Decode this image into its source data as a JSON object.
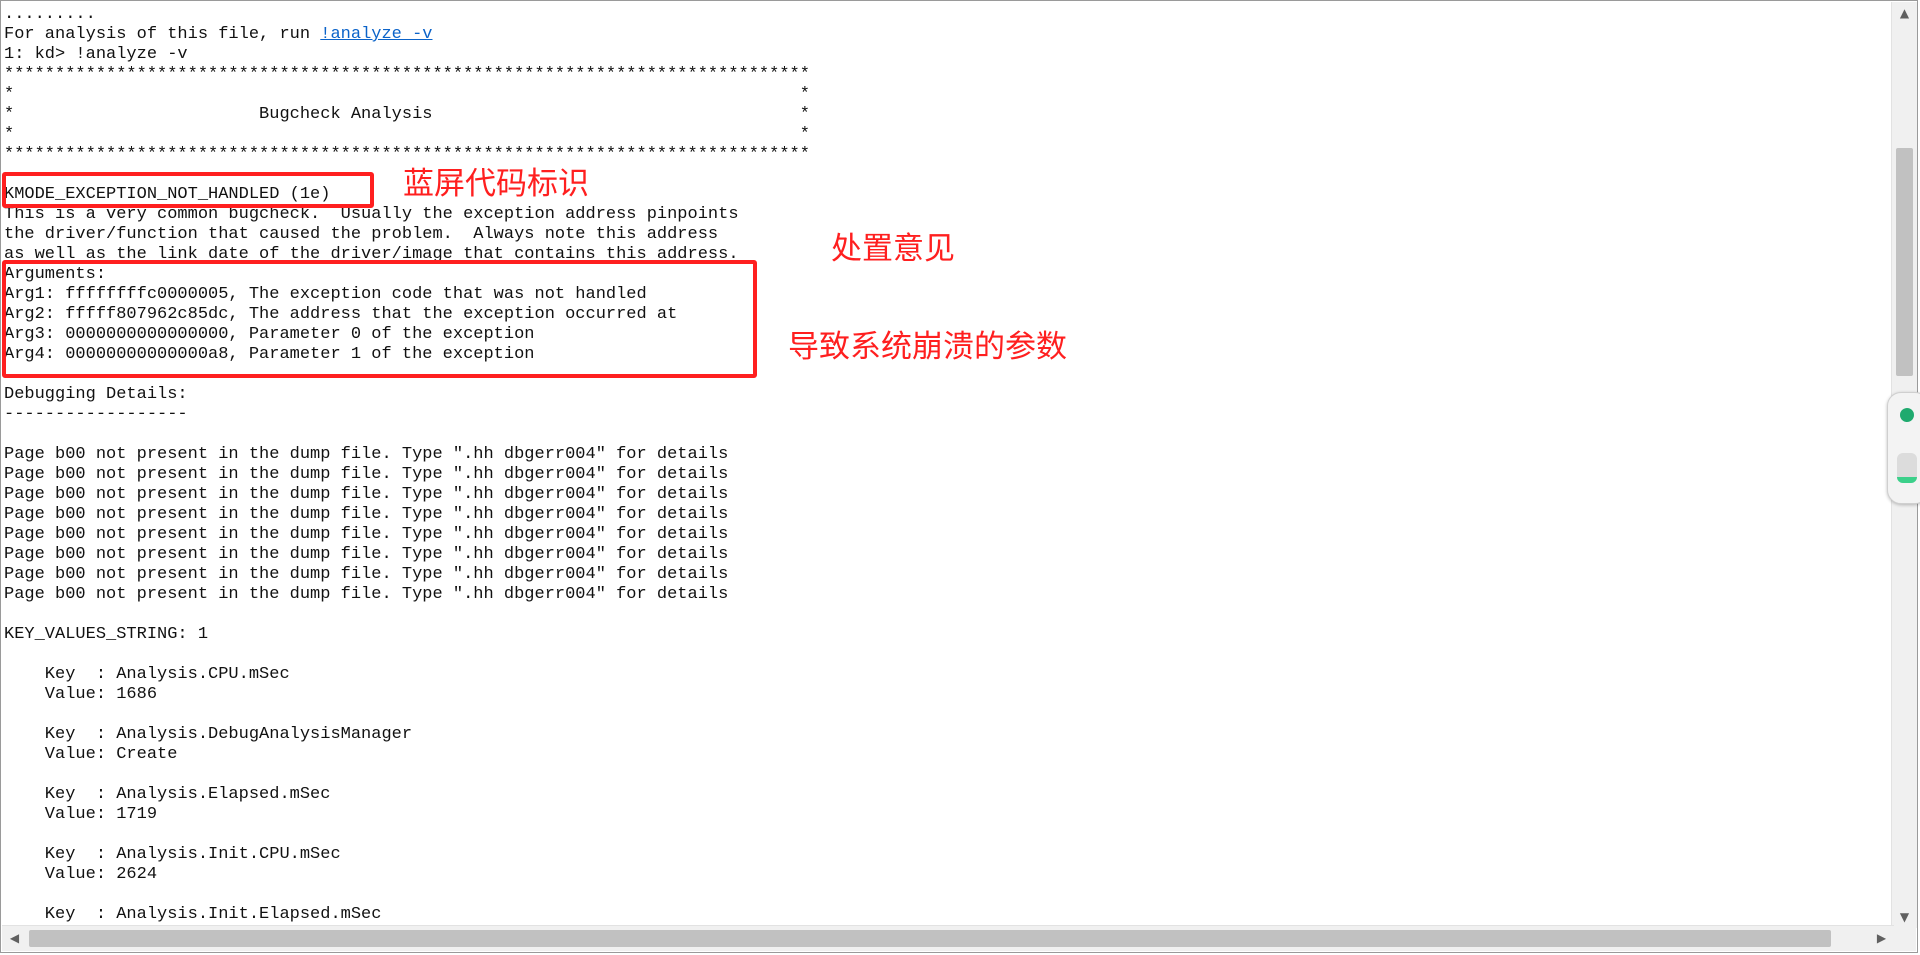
{
  "console": {
    "lines": [
      ".........",
      "For analysis of this file, run ",
      "1: kd> !analyze -v",
      "*******************************************************************************",
      "*                                                                             *",
      "*                        Bugcheck Analysis                                    *",
      "*                                                                             *",
      "*******************************************************************************",
      "",
      "KMODE_EXCEPTION_NOT_HANDLED (1e)",
      "This is a very common bugcheck.  Usually the exception address pinpoints",
      "the driver/function that caused the problem.  Always note this address",
      "as well as the link date of the driver/image that contains this address.",
      "Arguments:",
      "Arg1: ffffffffc0000005, The exception code that was not handled",
      "Arg2: fffff807962c85dc, The address that the exception occurred at",
      "Arg3: 0000000000000000, Parameter 0 of the exception",
      "Arg4: 00000000000000a8, Parameter 1 of the exception",
      "",
      "Debugging Details:",
      "------------------",
      "",
      "Page b00 not present in the dump file. Type \".hh dbgerr004\" for details",
      "Page b00 not present in the dump file. Type \".hh dbgerr004\" for details",
      "Page b00 not present in the dump file. Type \".hh dbgerr004\" for details",
      "Page b00 not present in the dump file. Type \".hh dbgerr004\" for details",
      "Page b00 not present in the dump file. Type \".hh dbgerr004\" for details",
      "Page b00 not present in the dump file. Type \".hh dbgerr004\" for details",
      "Page b00 not present in the dump file. Type \".hh dbgerr004\" for details",
      "Page b00 not present in the dump file. Type \".hh dbgerr004\" for details",
      "",
      "KEY_VALUES_STRING: 1",
      "",
      "    Key  : Analysis.CPU.mSec",
      "    Value: 1686",
      "",
      "    Key  : Analysis.DebugAnalysisManager",
      "    Value: Create",
      "",
      "    Key  : Analysis.Elapsed.mSec",
      "    Value: 1719",
      "",
      "    Key  : Analysis.Init.CPU.mSec",
      "    Value: 2624",
      "",
      "    Key  : Analysis.Init.Elapsed.mSec"
    ],
    "link_text": "!analyze -v"
  },
  "annotations": {
    "bugcheck_code_label": "蓝屏代码标识",
    "advice_label": "处置意见",
    "crash_params_label": "导致系统崩溃的参数",
    "color": "#ff1f1f"
  },
  "scrollbars": {
    "vertical": {
      "up_icon": "chevron-up-icon",
      "down_icon": "chevron-down-icon"
    },
    "horizontal": {
      "left_icon": "chevron-left-icon",
      "right_icon": "chevron-right-icon"
    }
  },
  "side_widget": {
    "icon": "status-dot-icon"
  }
}
